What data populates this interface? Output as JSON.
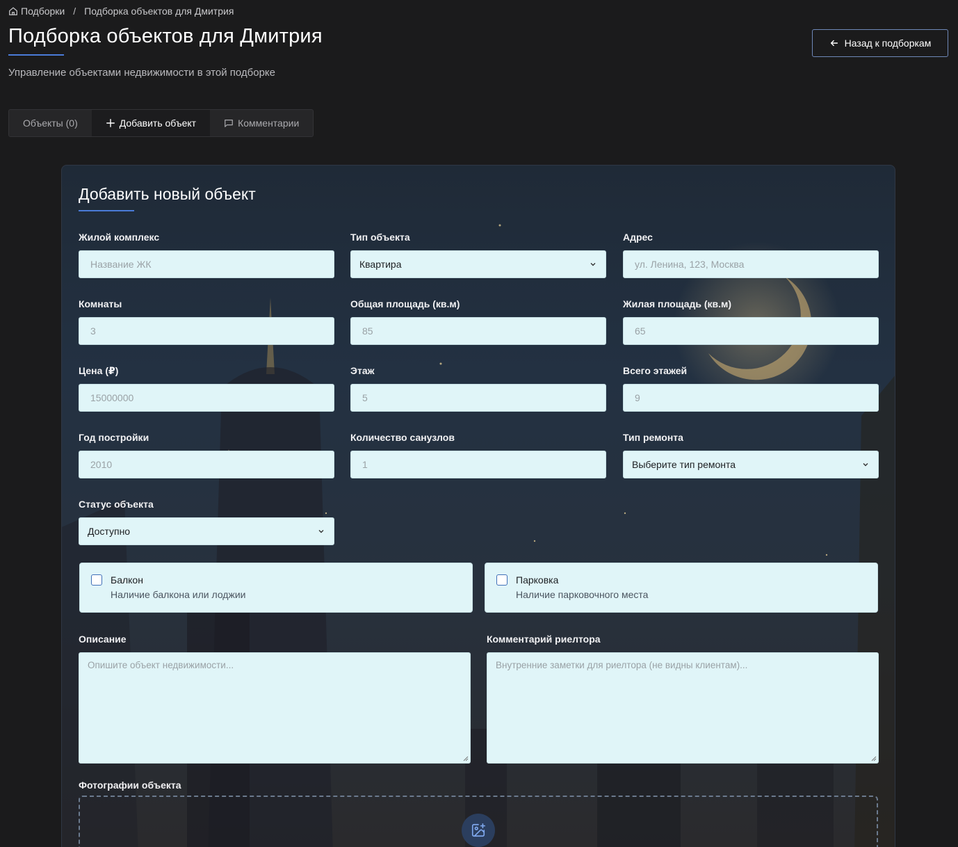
{
  "breadcrumb": {
    "root": "Подборки",
    "separator": "/",
    "current": "Подборка объектов для Дмитрия",
    "root_icon": "home-icon"
  },
  "header": {
    "title": "Подборка объектов для Дмитрия",
    "subtitle": "Управление объектами недвижимости в этой подборке",
    "back_button": "Назад к подборкам",
    "accent_color": "#4a7bd8"
  },
  "tabs": [
    {
      "label": "Объекты (0)",
      "icon": null,
      "active": false
    },
    {
      "label": "Добавить объект",
      "icon": "plus-icon",
      "active": true
    },
    {
      "label": "Комментарии",
      "icon": "message-square-icon",
      "active": false
    }
  ],
  "form": {
    "title": "Добавить новый объект",
    "complex": {
      "label": "Жилой комплекс",
      "placeholder": "Название ЖК"
    },
    "type": {
      "label": "Тип объекта",
      "value": "Квартира"
    },
    "address": {
      "label": "Адрес",
      "placeholder": "ул. Ленина, 123, Москва"
    },
    "rooms": {
      "label": "Комнаты",
      "placeholder": "3"
    },
    "total_area": {
      "label": "Общая площадь (кв.м)",
      "placeholder": "85"
    },
    "living_area": {
      "label": "Жилая площадь (кв.м)",
      "placeholder": "65"
    },
    "price": {
      "label": "Цена (₽)",
      "placeholder": "15000000"
    },
    "floor": {
      "label": "Этаж",
      "placeholder": "5"
    },
    "total_floors": {
      "label": "Всего этажей",
      "placeholder": "9"
    },
    "year": {
      "label": "Год постройки",
      "placeholder": "2010"
    },
    "bathrooms": {
      "label": "Количество санузлов",
      "placeholder": "1"
    },
    "renovation": {
      "label": "Тип ремонта",
      "value": "Выберите тип ремонта"
    },
    "status": {
      "label": "Статус объекта",
      "value": "Доступно"
    },
    "balcony": {
      "label": "Балкон",
      "description": "Наличие балкона или лоджии",
      "checked": false
    },
    "parking": {
      "label": "Парковка",
      "description": "Наличие парковочного места",
      "checked": false
    },
    "description": {
      "label": "Описание",
      "placeholder": "Опишите объект недвижимости..."
    },
    "realtor_comment": {
      "label": "Комментарий риелтора",
      "placeholder": "Внутренние заметки для риелтора (не видны клиентам)..."
    },
    "photos": {
      "label": "Фотографии объекта",
      "icon": "image-plus-icon"
    }
  }
}
